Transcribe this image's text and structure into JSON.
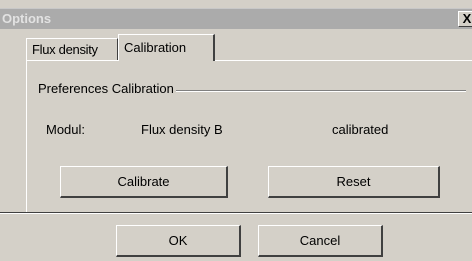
{
  "window": {
    "title": "Options",
    "close_glyph": "X"
  },
  "tabs": [
    {
      "label": "Flux density",
      "selected": false
    },
    {
      "label": "Calibration",
      "selected": true
    }
  ],
  "calibration": {
    "group_label": "Preferences Calibration",
    "modul_label": "Modul:",
    "modul_name": "Flux density B",
    "modul_status": "calibrated",
    "calibrate_label": "Calibrate",
    "reset_label": "Reset"
  },
  "footer": {
    "ok_label": "OK",
    "cancel_label": "Cancel"
  }
}
